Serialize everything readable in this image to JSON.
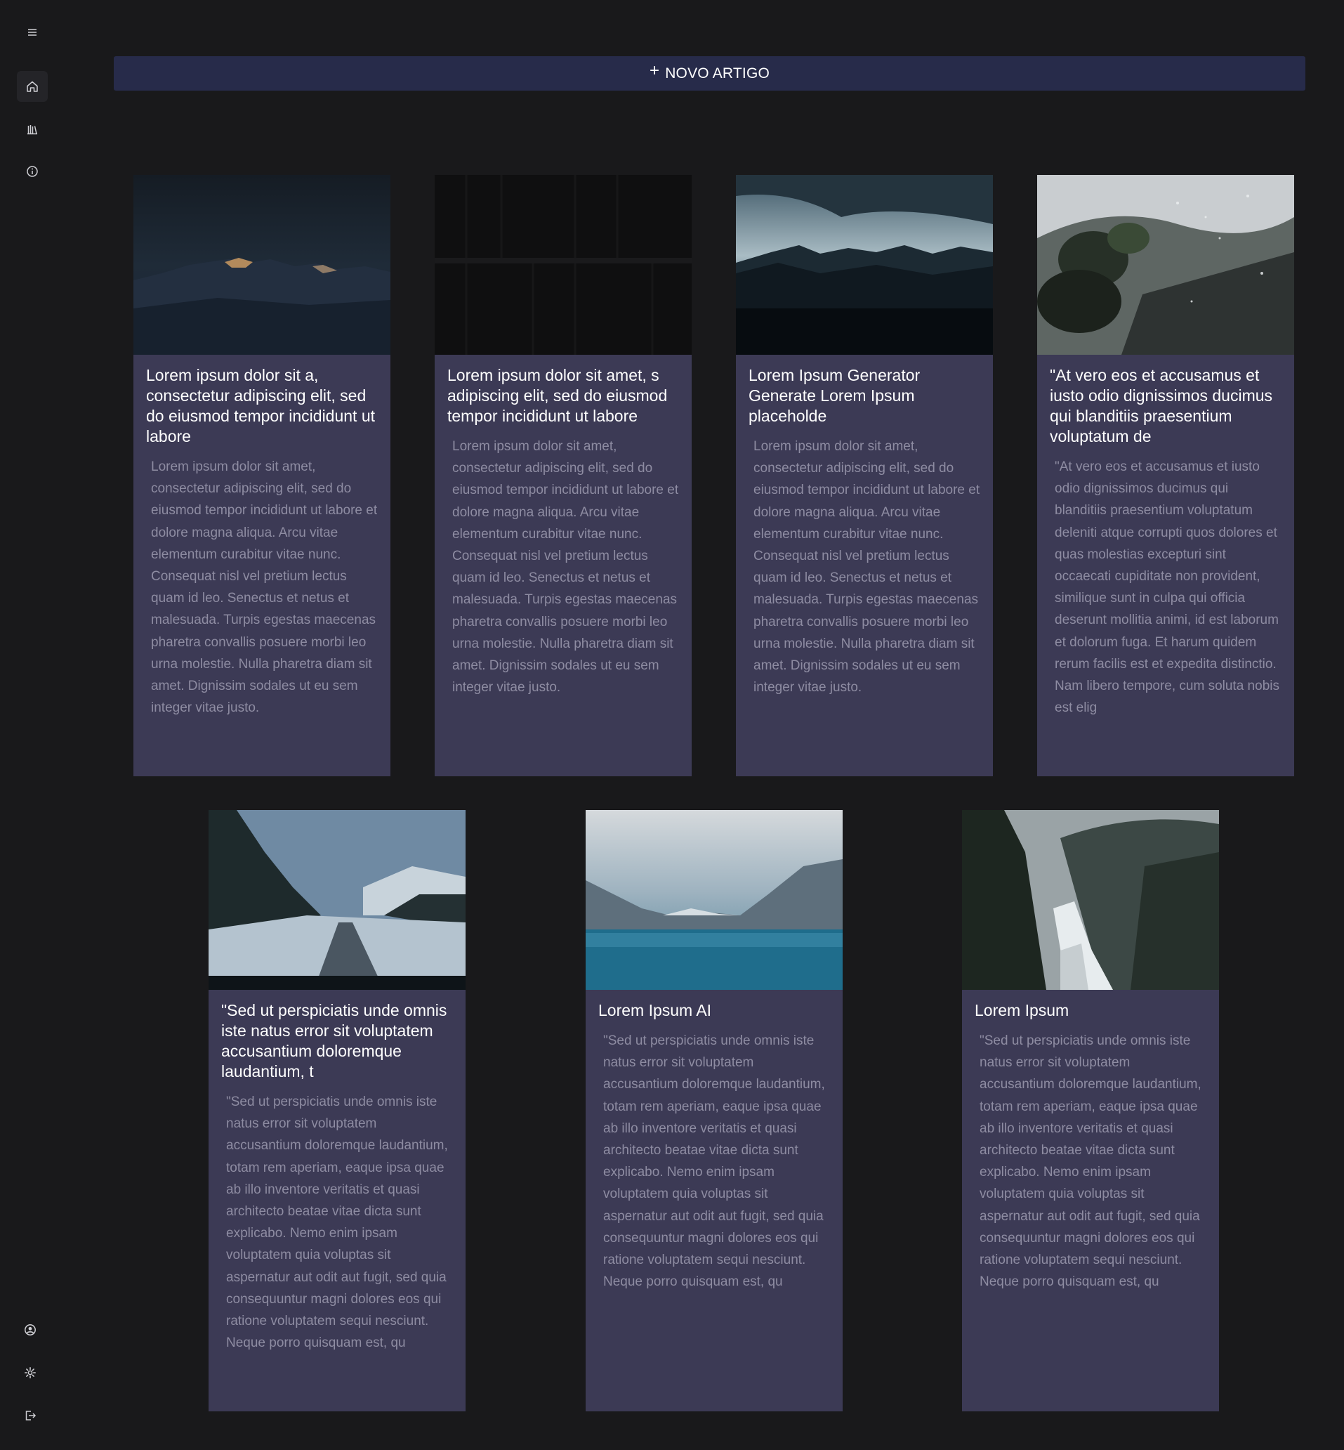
{
  "sidebar": {
    "top_icons": [
      "menu-icon",
      "home-icon",
      "library-icon",
      "info-icon"
    ],
    "bottom_icons": [
      "account-icon",
      "settings-icon",
      "logout-icon"
    ]
  },
  "toolbar": {
    "new_article_label": "NOVO ARTIGO",
    "plus_glyph": "+"
  },
  "colors": {
    "background": "#19191b",
    "card": "#3c3a55",
    "button": "#272b4a",
    "body_text": "#8e8ca2"
  },
  "cards": [
    {
      "image": "dark mountain range at dusk",
      "title": "Lorem ipsum dolor sit a, consectetur adipiscing elit, sed do eiusmod tempor incididunt ut labore",
      "body": "Lorem ipsum dolor sit amet, consectetur adipiscing elit, sed do eiusmod tempor incididunt ut labore et dolore magna aliqua. Arcu vitae elementum curabitur vitae nunc. Consequat nisl vel pretium lectus quam id leo. Senectus et netus et malesuada. Turpis egestas maecenas pharetra convallis posuere morbi leo urna molestie. Nulla pharetra diam sit amet. Dignissim sodales ut eu sem integer vitae justo."
    },
    {
      "image": "dark wooden planks",
      "title": "Lorem ipsum dolor sit amet, s adipiscing elit, sed do eiusmod tempor incididunt ut labore",
      "body": "Lorem ipsum dolor sit amet, consectetur adipiscing elit, sed do eiusmod tempor incididunt ut labore et dolore magna aliqua. Arcu vitae elementum curabitur vitae nunc. Consequat nisl vel pretium lectus quam id leo. Senectus et netus et malesuada. Turpis egestas maecenas pharetra convallis posuere morbi leo urna molestie. Nulla pharetra diam sit amet. Dignissim sodales ut eu sem integer vitae justo."
    },
    {
      "image": "mountains under cloudy sky",
      "title": "Lorem Ipsum Generator Generate Lorem Ipsum placeholde",
      "body": "Lorem ipsum dolor sit amet, consectetur adipiscing elit, sed do eiusmod tempor incididunt ut labore et dolore magna aliqua. Arcu vitae elementum curabitur vitae nunc. Consequat nisl vel pretium lectus quam id leo. Senectus et netus et malesuada. Turpis egestas maecenas pharetra convallis posuere morbi leo urna molestie. Nulla pharetra diam sit amet. Dignissim sodales ut eu sem integer vitae justo."
    },
    {
      "image": "leaves and rain drops",
      "title": "\"At vero eos et accusamus et iusto odio dignissimos ducimus qui blanditiis praesentium voluptatum de",
      "body": "\"At vero eos et accusamus et iusto odio dignissimos ducimus qui blanditiis praesentium voluptatum deleniti atque corrupti quos dolores et quas molestias excepturi sint occaecati cupiditate non provident, similique sunt in culpa qui officia deserunt mollitia animi, id est laborum et dolorum fuga. Et harum quidem rerum facilis est et expedita distinctio. Nam libero tempore, cum soluta nobis est elig"
    },
    {
      "image": "snowy road through forest",
      "title": "\"Sed ut perspiciatis unde omnis iste natus error sit voluptatem accusantium doloremque laudantium, t",
      "body": "\"Sed ut perspiciatis unde omnis iste natus error sit voluptatem accusantium doloremque laudantium, totam rem aperiam, eaque ipsa quae ab illo inventore veritatis et quasi architecto beatae vitae dicta sunt explicabo. Nemo enim ipsam voluptatem quia voluptas sit aspernatur aut odit aut fugit, sed quia consequuntur magni dolores eos qui ratione voluptatem sequi nesciunt. Neque porro quisquam est, qu"
    },
    {
      "image": "turquoise mountain lake",
      "title": "Lorem Ipsum AI",
      "body": "\"Sed ut perspiciatis unde omnis iste natus error sit voluptatem accusantium doloremque laudantium, totam rem aperiam, eaque ipsa quae ab illo inventore veritatis et quasi architecto beatae vitae dicta sunt explicabo. Nemo enim ipsam voluptatem quia voluptas sit aspernatur aut odit aut fugit, sed quia consequuntur magni dolores eos qui ratione voluptatem sequi nesciunt. Neque porro quisquam est, qu"
    },
    {
      "image": "waterfall in misty forest",
      "title": "Lorem Ipsum",
      "body": "\"Sed ut perspiciatis unde omnis iste natus error sit voluptatem accusantium doloremque laudantium, totam rem aperiam, eaque ipsa quae ab illo inventore veritatis et quasi architecto beatae vitae dicta sunt explicabo. Nemo enim ipsam voluptatem quia voluptas sit aspernatur aut odit aut fugit, sed quia consequuntur magni dolores eos qui ratione voluptatem sequi nesciunt. Neque porro quisquam est, qu"
    }
  ]
}
